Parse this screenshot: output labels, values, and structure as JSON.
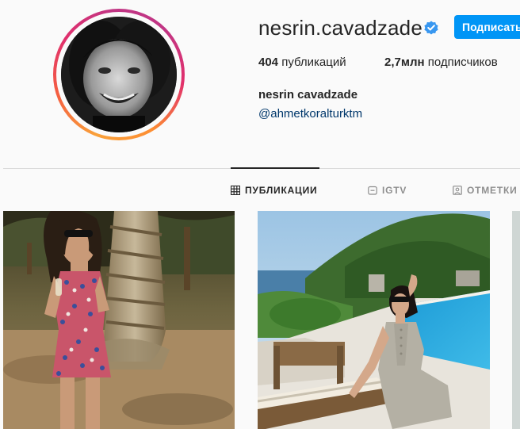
{
  "profile": {
    "username": "nesrin.cavadzade",
    "verified": true,
    "subscribe_label": "Подписаться",
    "stats": {
      "posts_count": "404",
      "posts_label": "публикаций",
      "followers_count": "2,7млн",
      "followers_label": "подписчиков"
    },
    "full_name": "nesrin cavadzade",
    "bio_link": "@ahmetkoralturktm"
  },
  "tabs": [
    {
      "label": "ПУБЛИКАЦИИ",
      "icon": "grid-icon",
      "active": true
    },
    {
      "label": "IGTV",
      "icon": "igtv-icon",
      "active": false
    },
    {
      "label": "ОТМЕТКИ",
      "icon": "tagged-icon",
      "active": false
    }
  ],
  "colors": {
    "accent": "#0095f6",
    "link": "#00376b",
    "text": "#262626",
    "muted": "#8e8e8e",
    "verified": "#3897f0"
  }
}
